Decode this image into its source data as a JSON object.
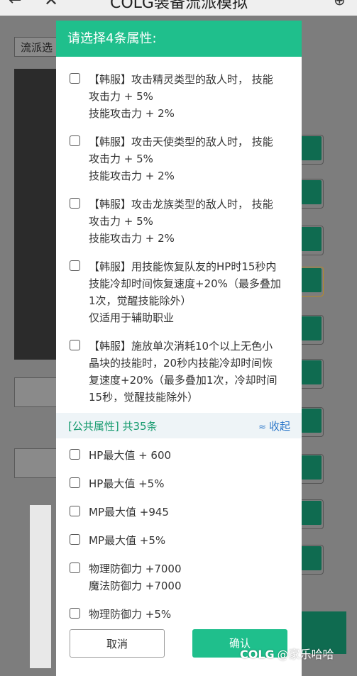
{
  "top_bar": {
    "back_icon": "←",
    "close_icon": "✕",
    "title": "COLG装备流派模拟",
    "more_icon": "⊕"
  },
  "background": {
    "chip_label": "流派选"
  },
  "modal": {
    "title": "请选择4条属性:",
    "options": [
      {
        "lines": [
          "【韩服】攻击精灵类型的敌人时， 技能",
          "攻击力 + 5%",
          "技能攻击力 + 2%"
        ]
      },
      {
        "lines": [
          "【韩服】攻击天使类型的敌人时， 技能",
          "攻击力 + 5%",
          "技能攻击力 + 2%"
        ]
      },
      {
        "lines": [
          "【韩服】攻击龙族类型的敌人时， 技能",
          "攻击力 + 5%",
          "技能攻击力 + 2%"
        ]
      },
      {
        "lines": [
          "【韩服】用技能恢复队友的HP时15秒内",
          "技能冷却时间恢复速度+20%（最多叠加",
          "1次，觉醒技能除外）",
          "仅适用于辅助职业"
        ]
      },
      {
        "lines": [
          "【韩服】施放单次消耗10个以上无色小",
          "晶块的技能时，20秒内技能冷却时间恢",
          "复速度+20%（最多叠加1次，冷却时间",
          "15秒，觉醒技能除外）"
        ]
      }
    ],
    "section": {
      "label": "[公共属性] 共35条",
      "collapse_label": "收起",
      "collapse_icon": "≈"
    },
    "public_options": [
      {
        "lines": [
          "HP最大值 + 600"
        ]
      },
      {
        "lines": [
          "HP最大值 +5%"
        ]
      },
      {
        "lines": [
          "MP最大值 +945"
        ]
      },
      {
        "lines": [
          "MP最大值 +5%"
        ]
      },
      {
        "lines": [
          "物理防御力 +7000",
          "魔法防御力 +7000"
        ]
      },
      {
        "lines": [
          "物理防御力 +5%"
        ]
      }
    ],
    "cancel_label": "取消",
    "confirm_label": "确认"
  },
  "watermark": {
    "logo": "COLG",
    "text": "@家乐哈哈"
  },
  "colors": {
    "accent": "#1fbf8c",
    "section_text": "#159a6e",
    "link": "#2b77c9"
  }
}
